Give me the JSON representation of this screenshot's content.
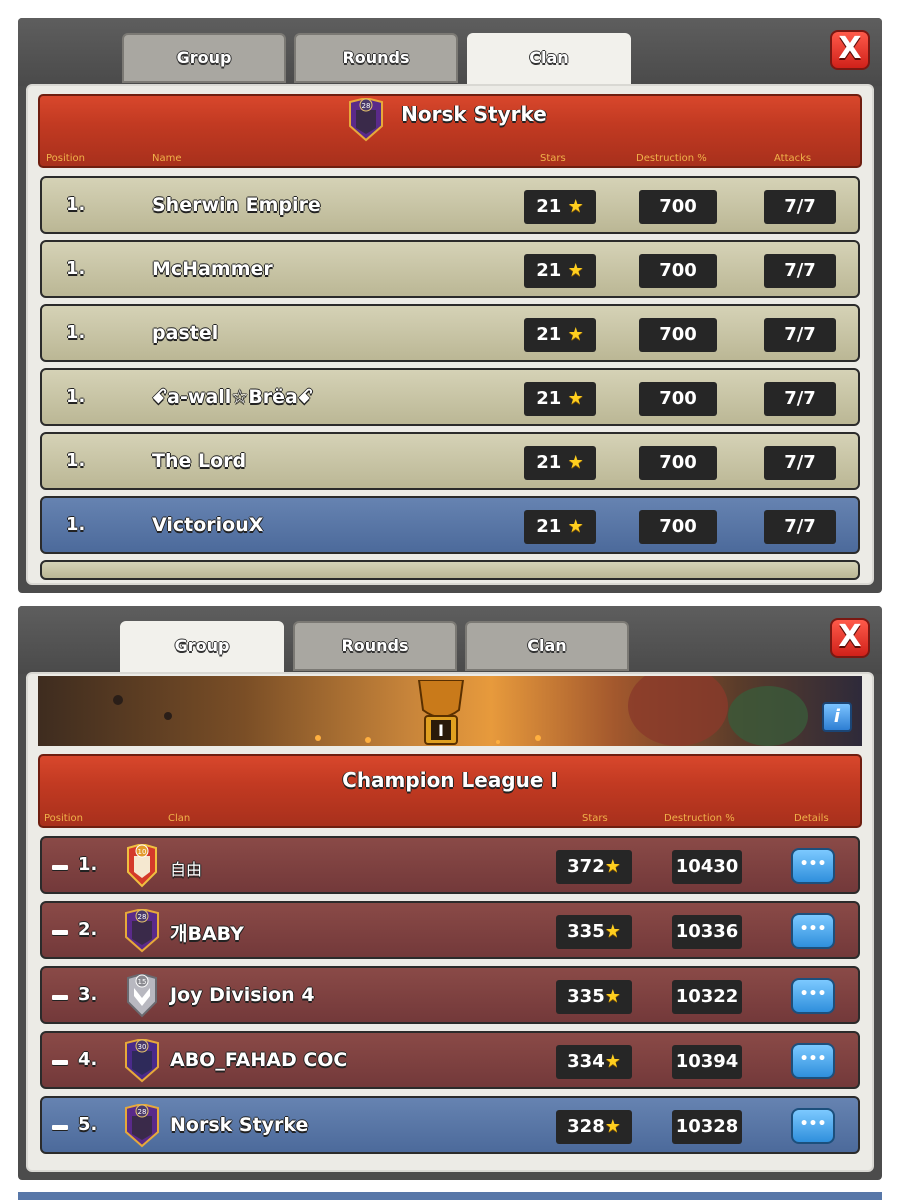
{
  "top_panel": {
    "tabs": [
      "Group",
      "Rounds",
      "Clan"
    ],
    "active_tab": "Clan",
    "close_label": "X",
    "clan": {
      "name": "Norsk Styrke",
      "badge_level": "28"
    },
    "columns": {
      "position": "Position",
      "name": "Name",
      "stars": "Stars",
      "destruction": "Destruction %",
      "attacks": "Attacks"
    },
    "rows": [
      {
        "position": "1.",
        "name": "Sherwin Empire",
        "stars": "21",
        "destruction": "700",
        "attacks": "7/7",
        "highlight": false
      },
      {
        "position": "1.",
        "name": "McHammer",
        "stars": "21",
        "destruction": "700",
        "attacks": "7/7",
        "highlight": false
      },
      {
        "position": "1.",
        "name": "pastel",
        "stars": "21",
        "destruction": "700",
        "attacks": "7/7",
        "highlight": false
      },
      {
        "position": "1.",
        "name": "ꗃa-wall☆Brëaꗃ",
        "stars": "21",
        "destruction": "700",
        "attacks": "7/7",
        "highlight": false
      },
      {
        "position": "1.",
        "name": "The Lord",
        "stars": "21",
        "destruction": "700",
        "attacks": "7/7",
        "highlight": false
      },
      {
        "position": "1.",
        "name": "VictoriouX",
        "stars": "21",
        "destruction": "700",
        "attacks": "7/7",
        "highlight": true
      }
    ]
  },
  "bottom_panel": {
    "tabs": [
      "Group",
      "Rounds",
      "Clan"
    ],
    "active_tab": "Group",
    "close_label": "X",
    "league_badge_text": "I",
    "info_label": "i",
    "league_title": "Champion League I",
    "columns": {
      "position": "Position",
      "clan": "Clan",
      "stars": "Stars",
      "destruction": "Destruction %",
      "details": "Details"
    },
    "rows": [
      {
        "position": "1.",
        "badge_level": "10",
        "name": "自由",
        "stars": "372",
        "destruction": "10430",
        "highlight": false
      },
      {
        "position": "2.",
        "badge_level": "28",
        "name": "개BABY",
        "stars": "335",
        "destruction": "10336",
        "highlight": false
      },
      {
        "position": "3.",
        "badge_level": "15",
        "name": "Joy Division 4",
        "stars": "335",
        "destruction": "10322",
        "highlight": false
      },
      {
        "position": "4.",
        "badge_level": "30",
        "name": "ABO_FAHAD COC",
        "stars": "334",
        "destruction": "10394",
        "highlight": false
      },
      {
        "position": "5.",
        "badge_level": "28",
        "name": "Norsk Styrke",
        "stars": "328",
        "destruction": "10328",
        "highlight": true
      }
    ],
    "details_label": "•••"
  },
  "colors": {
    "tan_row": "#c9c6a7",
    "maroon_row": "#7e4142",
    "blue_row": "#5877a8",
    "banner": "#c23a22",
    "star": "#ffcf1f"
  }
}
